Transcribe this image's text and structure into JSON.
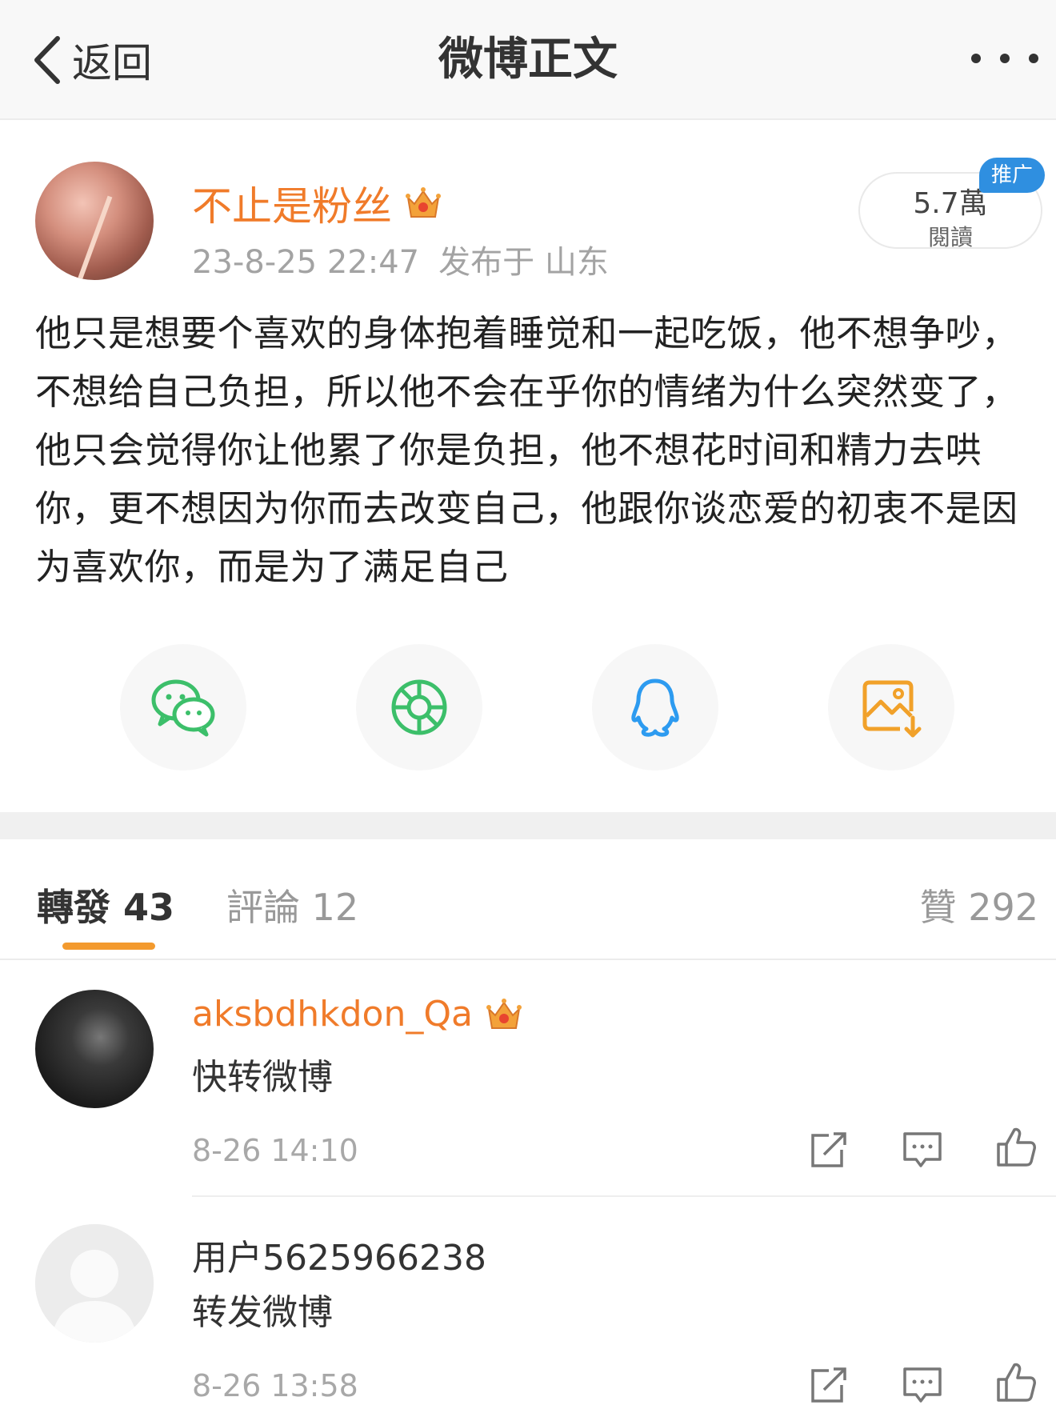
{
  "header": {
    "back_label": "返回",
    "title": "微博正文"
  },
  "post": {
    "username": "不止是粉丝",
    "date": "23-8-25 22:47",
    "location": "发布于 山东",
    "views_count": "5.7萬",
    "views_label": "閱讀",
    "promo_badge": "推广",
    "content": "他只是想要个喜欢的身体抱着睡觉和一起吃饭，他不想争吵，不想给自己负担，所以他不会在乎你的情绪为什么突然变了，他只会觉得你让他累了你是负担，他不想花时间和精力去哄你，更不想因为你而去改变自己，他跟你谈恋爱的初衷不是因为喜欢你，而是为了满足自己"
  },
  "share_icons": [
    "wechat-icon",
    "moments-icon",
    "qq-icon",
    "save-image-icon"
  ],
  "tabs": {
    "repost": "轉發 43",
    "comment": "評論 12",
    "like": "贊 292"
  },
  "comments": [
    {
      "username": "aksbdhkdon_Qa",
      "text": "快转微博",
      "time": "8-26 14:10"
    },
    {
      "username": "用户5625966238",
      "text": "转发微博",
      "time": "8-26 13:58"
    }
  ],
  "colors": {
    "accent": "#f07b2a",
    "underline": "#f39a2e",
    "promo": "#2f8fe0"
  }
}
